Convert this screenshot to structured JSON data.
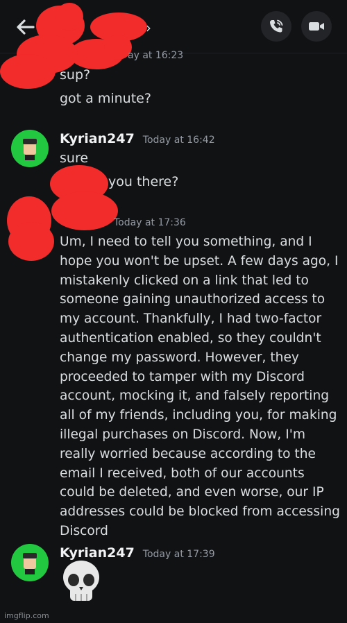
{
  "header": {
    "title": "",
    "chevron": "›",
    "back_icon": "arrow-left-icon",
    "call_icon": "phone-call-icon",
    "video_icon": "video-camera-icon"
  },
  "messages": {
    "first": {
      "timestamp": "ay at 16:23",
      "lines": [
        "sup?",
        "got a minute?"
      ]
    },
    "second": {
      "author": "Kyrian247",
      "timestamp": "Today at 16:42",
      "lines": [
        "sure",
        "you there?"
      ]
    },
    "third": {
      "timestamp": "Today at 17:36",
      "text": "Um, I need to tell you something, and I hope you won't be upset. A few days ago, I mistakenly clicked on a link that led to someone gaining unauthorized access to my account. Thankfully, I had two-factor authentication enabled, so they couldn't change my password. However, they proceeded to tamper with my Discord account, mocking it, and falsely reporting all of my friends, including you, for making illegal purchases on Discord. Now, I'm really worried because according to the email I received, both of our accounts could be deleted, and even worse, our IP addresses could be blocked from accessing Discord"
    },
    "fourth": {
      "author": "Kyrian247",
      "timestamp": "Today at 17:39",
      "emoji": "skull-emoji"
    }
  },
  "watermark": "imgflip.com",
  "colors": {
    "background": "#111214",
    "text": "#dbdee1",
    "timestamp": "#949ba4",
    "avatar": "#22c940",
    "redaction": "#f22b2b"
  }
}
